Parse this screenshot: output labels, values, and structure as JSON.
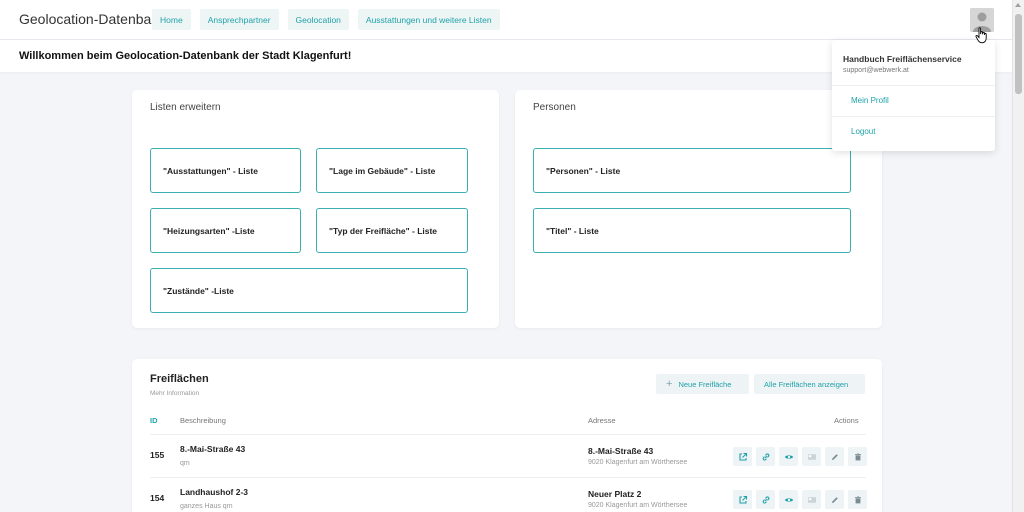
{
  "header": {
    "brand": "Geolocation-Datenbank",
    "nav": [
      "Home",
      "Ansprechpartner",
      "Geolocation",
      "Ausstattungen und weitere Listen"
    ]
  },
  "welcome": "Willkommen beim Geolocation-Datenbank der Stadt Klagenfurt!",
  "user_menu": {
    "name": "Handbuch Freiflächenservice",
    "email": "support@webwerk.at",
    "items": [
      "Mein Profil",
      "Logout"
    ]
  },
  "listen": {
    "title": "Listen erweitern",
    "buttons": [
      "\"Ausstattungen\" - Liste",
      "\"Lage im Gebäude\" - Liste",
      "\"Heizungsarten\" -Liste",
      "\"Typ der Freifläche\" - Liste",
      "\"Zustände\" -Liste"
    ]
  },
  "personen": {
    "title": "Personen",
    "buttons": [
      "\"Personen\" - Liste",
      "\"Titel\" - Liste"
    ]
  },
  "freiflaechen": {
    "title": "Freiflächen",
    "subtitle": "Mehr Information",
    "new_label": "Neue Freifläche",
    "all_label": "Alle Freiflächen anzeigen",
    "columns": {
      "id": "ID",
      "desc": "Beschreibung",
      "address": "Adresse",
      "actions": "Actions"
    },
    "rows": [
      {
        "id": "155",
        "desc": "8.-Mai-Straße 43",
        "desc_sub": "qm",
        "address": "8.-Mai-Straße 43",
        "address_sub": "9020 Klagenfurt am Wörthersee"
      },
      {
        "id": "154",
        "desc": "Landhaushof 2-3",
        "desc_sub": "ganzes Haus qm",
        "address": "Neuer Platz 2",
        "address_sub": "9020 Klagenfurt am Wörthersee"
      }
    ],
    "action_icons": [
      "external-link-icon",
      "link-icon",
      "eye-icon",
      "card-icon",
      "pencil-icon",
      "trash-icon"
    ]
  },
  "colors": {
    "accent": "#1fa2a9",
    "border": "#3aaeb1",
    "background": "#f3f5f8"
  }
}
